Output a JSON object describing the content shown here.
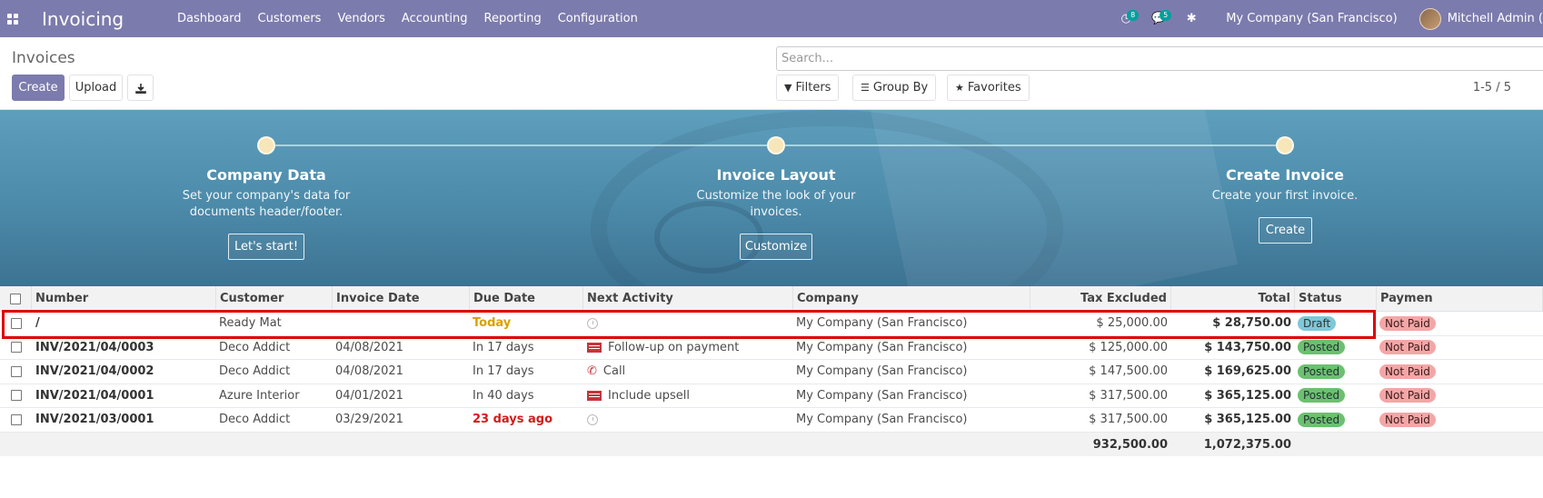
{
  "navbar": {
    "brand": "Invoicing",
    "menu": [
      "Dashboard",
      "Customers",
      "Vendors",
      "Accounting",
      "Reporting",
      "Configuration"
    ],
    "activity_badge": "8",
    "messages_badge": "5",
    "company": "My Company (San Francisco)",
    "user": "Mitchell Admin ("
  },
  "control": {
    "title": "Invoices",
    "create_label": "Create",
    "upload_label": "Upload",
    "search_placeholder": "Search...",
    "filters_label": "Filters",
    "group_by_label": "Group By",
    "favorites_label": "Favorites",
    "pager": "1-5 / 5"
  },
  "onboarding": {
    "steps": [
      {
        "title": "Company Data",
        "desc1": "Set your company's data for",
        "desc2": "documents header/footer.",
        "button": "Let's start!"
      },
      {
        "title": "Invoice Layout",
        "desc1": "Customize the look of your",
        "desc2": "invoices.",
        "button": "Customize"
      },
      {
        "title": "Create Invoice",
        "desc1": "Create your first invoice.",
        "desc2": "",
        "button": "Create"
      }
    ]
  },
  "table": {
    "columns": [
      "Number",
      "Customer",
      "Invoice Date",
      "Due Date",
      "Next Activity",
      "Company",
      "Tax Excluded",
      "Total",
      "Status",
      "Paymen"
    ],
    "rows": [
      {
        "number": "/",
        "customer": "Ready Mat",
        "invoice_date": "",
        "due_date": "Today",
        "activity": "",
        "company": "My Company (San Francisco)",
        "tax_excluded": "$ 25,000.00",
        "total": "$ 28,750.00",
        "status": "Draft",
        "payment": "Not Paid"
      },
      {
        "number": "INV/2021/04/0003",
        "customer": "Deco Addict",
        "invoice_date": "04/08/2021",
        "due_date": "In 17 days",
        "activity": "Follow-up on payment",
        "company": "My Company (San Francisco)",
        "tax_excluded": "$ 125,000.00",
        "total": "$ 143,750.00",
        "status": "Posted",
        "payment": "Not Paid"
      },
      {
        "number": "INV/2021/04/0002",
        "customer": "Deco Addict",
        "invoice_date": "04/08/2021",
        "due_date": "In 17 days",
        "activity": "Call",
        "company": "My Company (San Francisco)",
        "tax_excluded": "$ 147,500.00",
        "total": "$ 169,625.00",
        "status": "Posted",
        "payment": "Not Paid"
      },
      {
        "number": "INV/2021/04/0001",
        "customer": "Azure Interior",
        "invoice_date": "04/01/2021",
        "due_date": "In 40 days",
        "activity": "Include upsell",
        "company": "My Company (San Francisco)",
        "tax_excluded": "$ 317,500.00",
        "total": "$ 365,125.00",
        "status": "Posted",
        "payment": "Not Paid"
      },
      {
        "number": "INV/2021/03/0001",
        "customer": "Deco Addict",
        "invoice_date": "03/29/2021",
        "due_date": "23 days ago",
        "activity": "",
        "company": "My Company (San Francisco)",
        "tax_excluded": "$ 317,500.00",
        "total": "$ 365,125.00",
        "status": "Posted",
        "payment": "Not Paid"
      }
    ],
    "totals": {
      "tax_excluded": "932,500.00",
      "total": "1,072,375.00"
    }
  }
}
